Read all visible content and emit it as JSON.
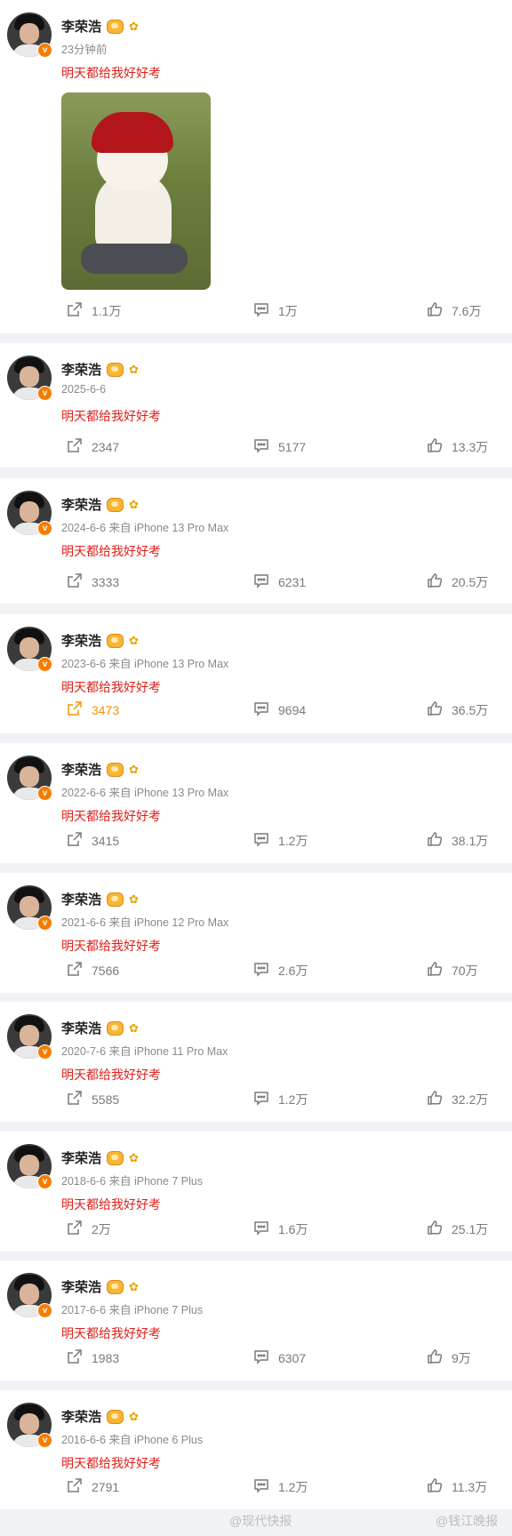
{
  "posts": [
    {
      "name": "李荣浩",
      "meta": "23分钟前",
      "text": "明天都给我好好考",
      "reposts": "1.1万",
      "comments": "1万",
      "likes": "7.6万"
    },
    {
      "name": "李荣浩",
      "meta": "2025-6-6",
      "text": "明天都给我好好考",
      "reposts": "2347",
      "comments": "5177",
      "likes": "13.3万"
    },
    {
      "name": "李荣浩",
      "meta": "2024-6-6 来自 iPhone 13 Pro Max",
      "text": "明天都给我好好考",
      "reposts": "3333",
      "comments": "6231",
      "likes": "20.5万"
    },
    {
      "name": "李荣浩",
      "meta": "2023-6-6 来自 iPhone 13 Pro Max",
      "text": "明天都给我好好考",
      "reposts": "3473",
      "comments": "9694",
      "likes": "36.5万"
    },
    {
      "name": "李荣浩",
      "meta": "2022-6-6 来自 iPhone 13 Pro Max",
      "text": "明天都给我好好考",
      "reposts": "3415",
      "comments": "1.2万",
      "likes": "38.1万"
    },
    {
      "name": "李荣浩",
      "meta": "2021-6-6 来自 iPhone 12 Pro Max",
      "text": "明天都给我好好考",
      "reposts": "7566",
      "comments": "2.6万",
      "likes": "70万"
    },
    {
      "name": "李荣浩",
      "meta": "2020-7-6 来自 iPhone 11 Pro Max",
      "text": "明天都给我好好考",
      "reposts": "5585",
      "comments": "1.2万",
      "likes": "32.2万"
    },
    {
      "name": "李荣浩",
      "meta": "2018-6-6 来自 iPhone 7 Plus",
      "text": "明天都给我好好考",
      "reposts": "2万",
      "comments": "1.6万",
      "likes": "25.1万"
    },
    {
      "name": "李荣浩",
      "meta": "2017-6-6 来自 iPhone 7 Plus",
      "text": "明天都给我好好考",
      "reposts": "1983",
      "comments": "6307",
      "likes": "9万"
    },
    {
      "name": "李荣浩",
      "meta": "2016-6-6 来自 iPhone 6 Plus",
      "text": "明天都给我好好考",
      "reposts": "2791",
      "comments": "1.2万",
      "likes": "11.3万"
    }
  ],
  "watermarks": [
    "@现代快报",
    "@钱江晚报"
  ],
  "colors": {
    "accent_text": "#e0201b",
    "highlight": "#f79200",
    "verified": "#f57c00",
    "muted": "#8a8a8a"
  },
  "icons": {
    "repost": "repost-icon",
    "comment": "comment-icon",
    "like": "like-icon",
    "verified": "verified-badge-icon"
  }
}
